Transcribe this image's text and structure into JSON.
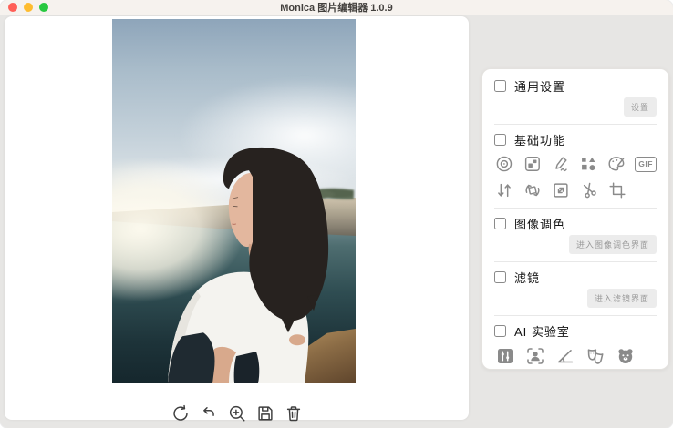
{
  "window": {
    "title": "Monica 图片编辑器 1.0.9"
  },
  "titlebar": {
    "traffic_lights": [
      "close",
      "minimize",
      "maximize"
    ]
  },
  "panel": {
    "general": {
      "label": "通用设置",
      "button_label": "设置"
    },
    "basic": {
      "label": "基础功能",
      "icons_row1": [
        {
          "name": "blur-circle-icon"
        },
        {
          "name": "collage-icon"
        },
        {
          "name": "doodle-pen-icon"
        },
        {
          "name": "shapes-icon"
        },
        {
          "name": "palette-icon"
        },
        {
          "name": "gif-icon",
          "text": "GIF"
        }
      ],
      "icons_row2": [
        {
          "name": "flip-vertical-icon"
        },
        {
          "name": "rotate-icon"
        },
        {
          "name": "resize-icon"
        },
        {
          "name": "scissors-icon"
        },
        {
          "name": "crop-icon"
        }
      ]
    },
    "color_grading": {
      "label": "图像调色",
      "button_label": "进入图像调色界面"
    },
    "filters": {
      "label": "滤镜",
      "button_label": "进入滤镜界面"
    },
    "ai_lab": {
      "label": "AI 实验室",
      "icons": [
        {
          "name": "adjust-sliders-icon"
        },
        {
          "name": "face-detect-icon"
        },
        {
          "name": "angle-icon"
        },
        {
          "name": "theater-masks-icon"
        },
        {
          "name": "bear-face-icon"
        }
      ]
    }
  },
  "toolbar": {
    "icons": [
      {
        "name": "rotate-ccw-icon"
      },
      {
        "name": "undo-icon"
      },
      {
        "name": "zoom-in-icon"
      },
      {
        "name": "save-icon"
      },
      {
        "name": "trash-icon"
      }
    ]
  },
  "colors": {
    "traffic_red": "#ff5f57",
    "traffic_yellow": "#febc2e",
    "traffic_green": "#28c840",
    "panel_icon_gray": "#8a8a8a",
    "toolbar_icon_dark": "#3f3f3f",
    "panel_bg": "#ffffff",
    "window_bg": "#e7e6e4",
    "button_bg": "#ececec",
    "button_text": "#9a9a9a"
  }
}
